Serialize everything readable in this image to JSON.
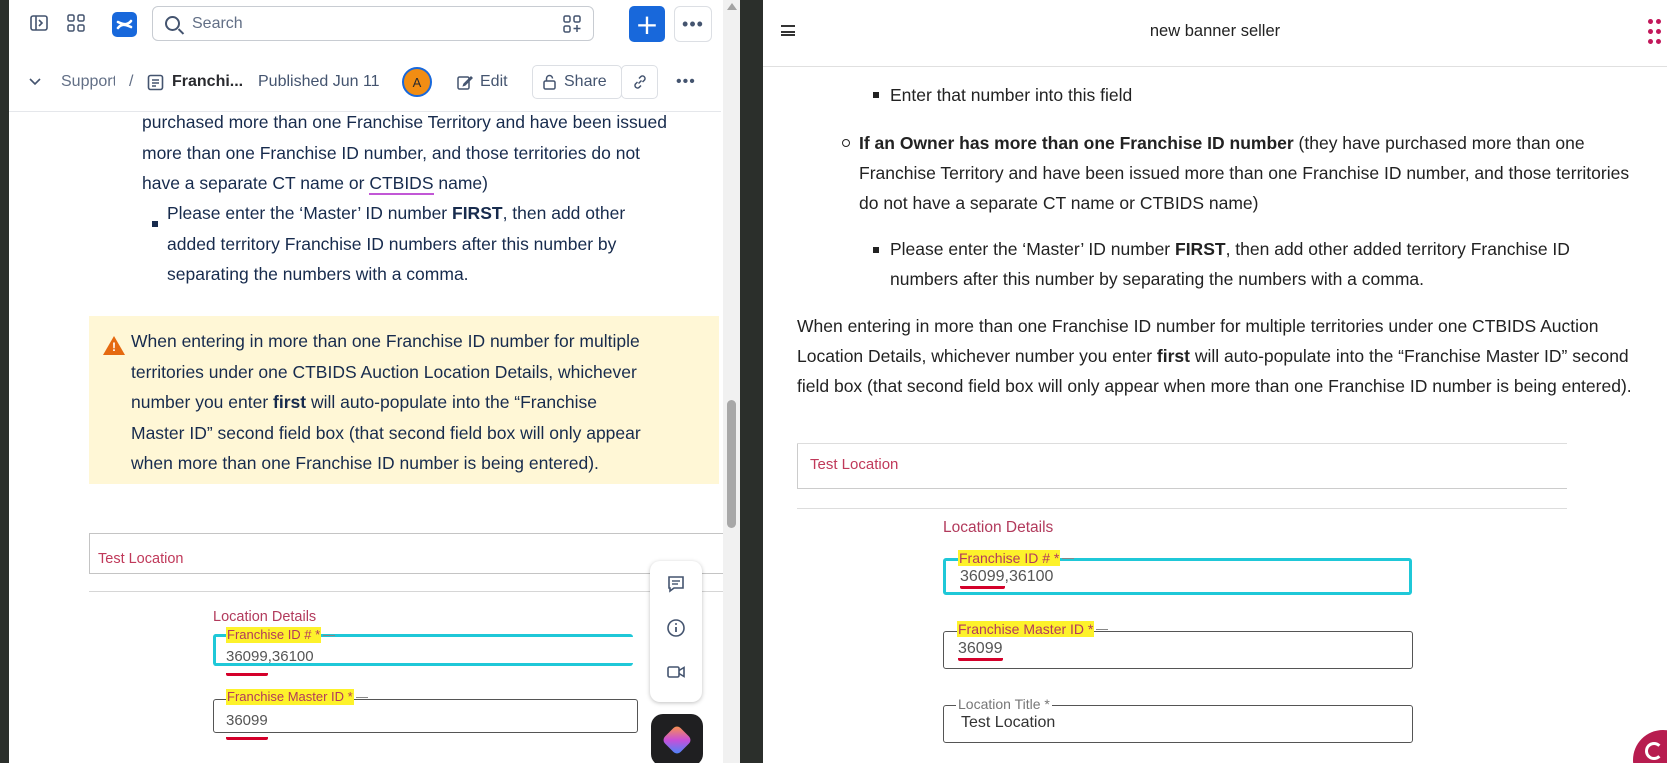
{
  "left": {
    "search_placeholder": "Search",
    "breadcrumb": {
      "space": "Support",
      "separator": "/",
      "page": "Franchi...",
      "status": "Published Jun 11"
    },
    "avatar_initial": "A",
    "edit_label": "Edit",
    "share_label": "Share",
    "intro_lines": [
      "purchased more than one Franchise Territory and have been issued",
      "more than one Franchise ID number, and those territories do not"
    ],
    "intro_line3_pre": "have a separate CT name or ",
    "intro_line3_term": "CTBIDS",
    "intro_line3_post": " name)",
    "bullet": {
      "pre": "Please enter the ‘Master’ ID number ",
      "bold": "FIRST",
      "post_l1": ", then add other",
      "line2": "added territory Franchise ID numbers after this number by",
      "line3": "separating the numbers with a comma."
    },
    "warning": {
      "line1": "When entering in more than one Franchise ID number for multiple",
      "line2": "territories under one CTBIDS Auction Location Details, whichever",
      "line3_pre": "number you enter ",
      "line3_bold": "first",
      "line3_post": " will auto-populate into the “Franchise",
      "line4": "Master ID” second field box (that second field box will only appear",
      "line5": "when more than one Franchise ID number is being entered)."
    },
    "embed": {
      "test_location": "Test Location",
      "location_details": "Location Details",
      "franchise_id_label": "Franchise ID # *",
      "franchise_id_value_first": "36099",
      "franchise_id_value_rest": ",36100",
      "master_id_label": "Franchise Master ID *",
      "master_id_value": "36099"
    }
  },
  "right": {
    "title": "new banner seller",
    "sub_bullet_top": "Enter that number into this field",
    "owner_bold": "If an Owner has more than one Franchise ID number",
    "owner_rest_l1": " (they have purchased more than one",
    "owner_l2": "Franchise Territory and have been issued more than one Franchise ID number, and those territories",
    "owner_l3": "do not have a separate CT name or CTBIDS name)",
    "bullet_pre": "Please enter the ‘Master’ ID number ",
    "bullet_bold": "FIRST",
    "bullet_post_l1": ", then add other added territory Franchise ID",
    "bullet_l2": "numbers after this number by separating the numbers with a comma.",
    "note_l1": "When entering in more than one Franchise ID number for multiple territories under one CTBIDS Auction",
    "note_l2_pre": "Location Details, whichever number you enter ",
    "note_l2_bold": "first",
    "note_l2_post": " will auto-populate into the “Franchise Master ID” second",
    "note_l3": "field box (that second field box will only appear when more than one Franchise ID number is being entered).",
    "embed": {
      "test_location": "Test Location",
      "location_details": "Location Details",
      "franchise_id_label": "Franchise ID # *",
      "franchise_id_value_first": "36099",
      "franchise_id_value_rest": ",36100",
      "master_id_label": "Franchise Master ID *",
      "master_id_value": "36099",
      "location_title_label": "Location Title *",
      "location_title_value": "Test Location"
    }
  },
  "colors": {
    "accent": "#1868db",
    "warning_bg": "#fff7d6",
    "highlight": "#fdf22b",
    "focus_border": "#1fc8d8",
    "label_red": "#b23a5c"
  }
}
